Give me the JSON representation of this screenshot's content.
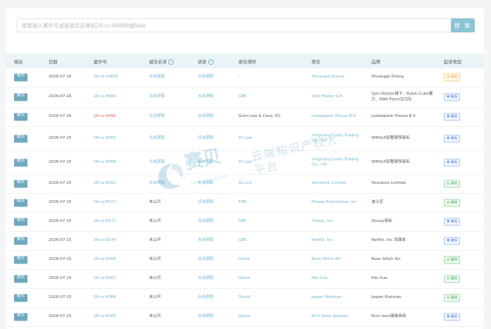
{
  "search": {
    "placeholder": "搜索输入案件号或者原告品牌如24-cv-06888或Nike",
    "button_label": "搜 索"
  },
  "table": {
    "headers": [
      "相关",
      "日期",
      "案件号",
      "被告名单",
      "诉状",
      "原告律所",
      "原告",
      "品牌",
      "起诉类型"
    ],
    "rows": [
      {
        "action": "报名",
        "date": "2026-07-16",
        "case": "26-cv-24832",
        "defendants": "点击获取",
        "complaint": "点击获取",
        "firm": "-",
        "plaintiff": "Shuangqi Zhang",
        "brand": "Shuangqi Zhang",
        "type": "专利",
        "case_red": false
      },
      {
        "action": "报名",
        "date": "2026-07-16",
        "case": "26-cv-8409",
        "defendants": "点击获取",
        "complaint": "点击获取",
        "firm": "GBC",
        "plaintiff": "Spin Master Ltd",
        "brand": "Spin Master旗下：Rubik Cube魔方、PAW Patrol汪汪队",
        "type": "商标",
        "case_red": false
      },
      {
        "action": "报名",
        "date": "2026-07-16",
        "case": "26-cv-4495",
        "defendants": "点击获取",
        "complaint": "点击获取",
        "firm": "Gunn Lee & Cave, P.C",
        "plaintiff": "Leidseplein Presse B.V",
        "brand": "Leidseplein Presse B.V",
        "type": "商标",
        "case_red": true
      },
      {
        "action": "报名",
        "date": "2026-07-15",
        "case": "26-cv-8385",
        "defendants": "点击获取",
        "complaint": "点击获取",
        "firm": "Yk Law",
        "plaintiff": "Yingxiang Suxiu Trading Co., Ltd",
        "brand": "WIKGUI轻奢服饰商标",
        "type": "商标",
        "case_red": false
      },
      {
        "action": "报名",
        "date": "2026-07-15",
        "case": "26-cv-8384",
        "defendants": "点击获取",
        "complaint": "点击获取",
        "firm": "Yk Law",
        "plaintiff": "Yingxiang Suxiu Trading Co., Ltd",
        "brand": "WIKGUI轻奢服饰商标",
        "type": "商标",
        "case_red": false
      },
      {
        "action": "报名",
        "date": "2026-07-15",
        "case": "26-cv-8381",
        "defendants": "点击获取",
        "complaint": "点击获取",
        "firm": "Au LLC",
        "plaintiff": "Yourstore Limited",
        "brand": "Yourstore Limited",
        "type": "版权",
        "case_red": false
      },
      {
        "action": "报名",
        "date": "2026-07-15",
        "case": "26-cv-8377",
        "defendants": "未公开",
        "complaint": "点击获取",
        "firm": "TME",
        "plaintiff": "Disney Enterprises, Inc",
        "brand": "迪士尼",
        "type": "版权",
        "case_red": false
      },
      {
        "action": "报名",
        "date": "2026-07-15",
        "case": "26-cv-8371",
        "defendants": "未公开",
        "complaint": "点击获取",
        "firm": "GBC",
        "plaintiff": "Stussy, Inc.",
        "brand": "Stussy商标",
        "type": "商标",
        "case_red": false
      },
      {
        "action": "报名",
        "date": "2026-07-15",
        "case": "26-cv-8370",
        "defendants": "未公开",
        "complaint": "点击获取",
        "firm": "GBC",
        "plaintiff": "Netflix, Inc.",
        "brand": "Netflix, Inc 流媒体",
        "type": "商标",
        "case_red": false
      },
      {
        "action": "报名",
        "date": "2026-07-15",
        "case": "26-cv-8368",
        "defendants": "未公开",
        "complaint": "点击获取",
        "firm": "David",
        "plaintiff": "Rose Stitch Art",
        "brand": "Rose Stitch Art",
        "type": "版权",
        "case_red": false
      },
      {
        "action": "报名",
        "date": "2026-07-15",
        "case": "26-cv-8367",
        "defendants": "未公开",
        "complaint": "点击获取",
        "firm": "David",
        "plaintiff": "Kiki Xue",
        "brand": "Kiki Xue",
        "type": "版权",
        "case_red": false
      },
      {
        "action": "报名",
        "date": "2026-07-15",
        "case": "26-cv-8366",
        "defendants": "未公开",
        "complaint": "点击获取",
        "firm": "David",
        "plaintiff": "Jasper Rietman",
        "brand": "Jasper Rietman",
        "type": "版权",
        "case_red": false
      },
      {
        "action": "报名",
        "date": "2026-07-15",
        "case": "26-cv-8365",
        "defendants": "未公开",
        "complaint": "点击获取",
        "firm": "David",
        "plaintiff": "Rich Soon Apparel",
        "brand": "Rich soon服装券商",
        "type": "商标",
        "case_red": false
      }
    ]
  },
  "watermark": {
    "name": "赛贝",
    "tagline": "云端知识产权大平台",
    "url": "www.saibeiip.com"
  },
  "colors": {
    "accent": "#6fa9be",
    "link": "#6ab3cf",
    "red": "#e8574a"
  }
}
